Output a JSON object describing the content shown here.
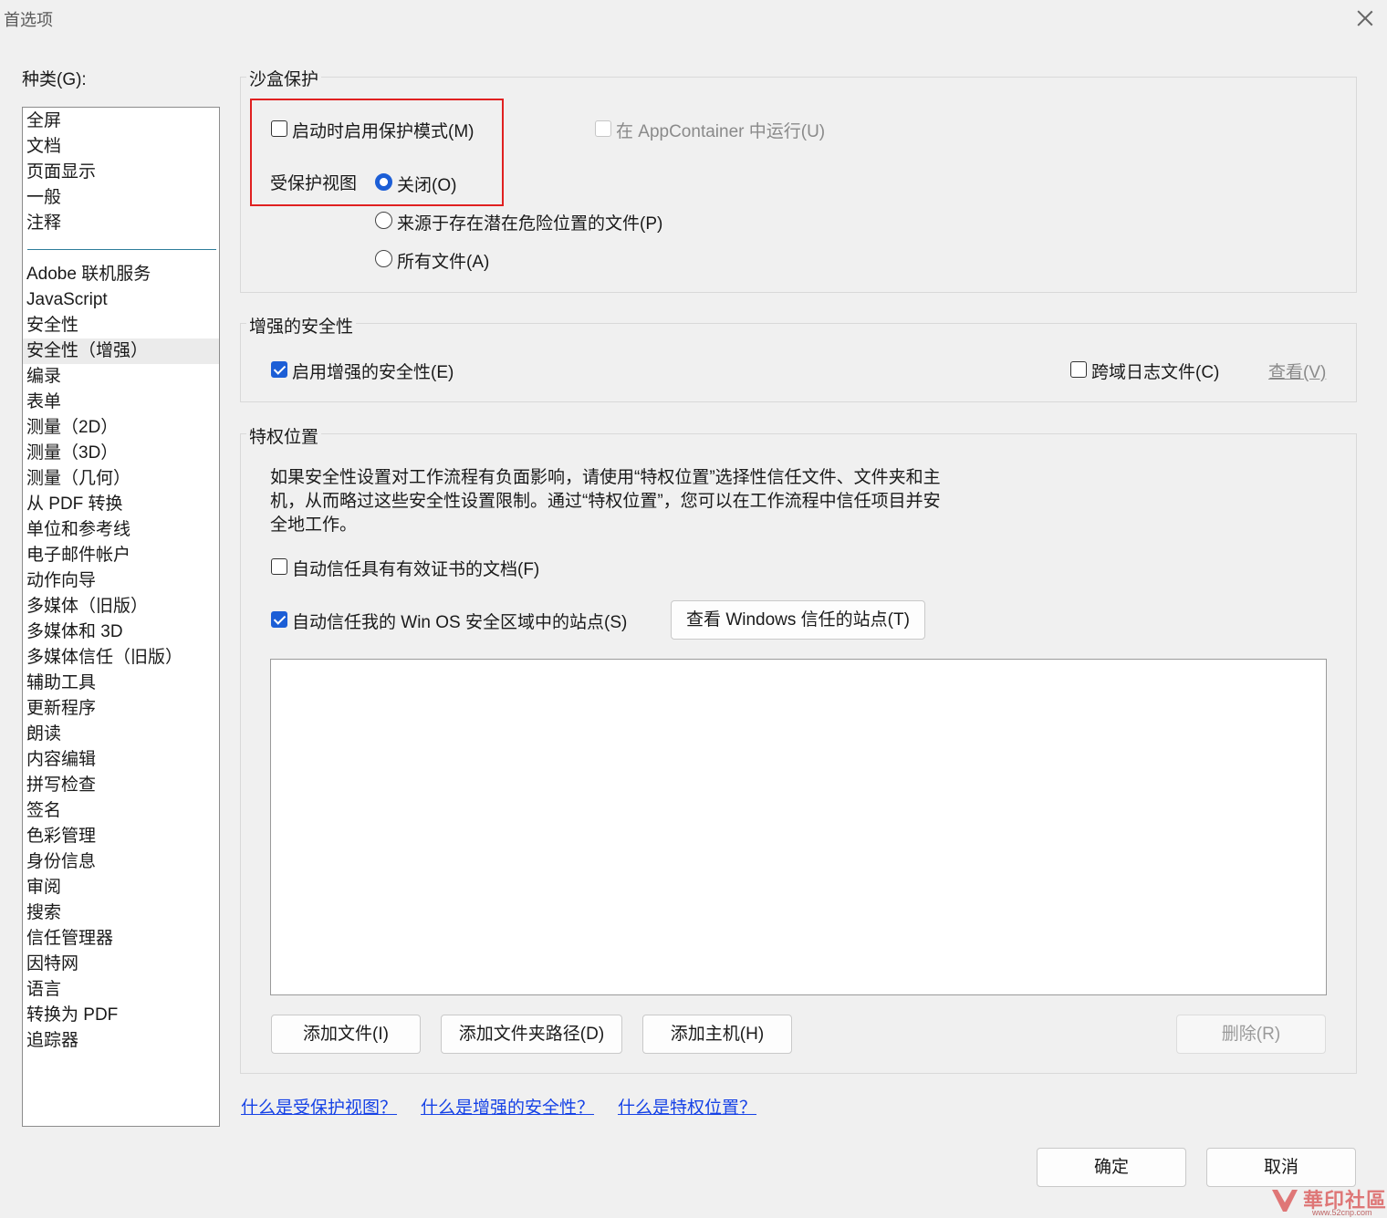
{
  "window": {
    "title": "首选项"
  },
  "categories": {
    "label": "种类(G):",
    "group1": [
      "全屏",
      "文档",
      "页面显示",
      "一般",
      "注释"
    ],
    "group2": [
      "Adobe 联机服务",
      "JavaScript",
      "安全性",
      "安全性（增强）",
      "编录",
      "表单",
      "测量（2D）",
      "测量（3D）",
      "测量（几何）",
      "从 PDF 转换",
      "单位和参考线",
      "电子邮件帐户",
      "动作向导",
      "多媒体（旧版）",
      "多媒体和 3D",
      "多媒体信任（旧版）",
      "辅助工具",
      "更新程序",
      "朗读",
      "内容编辑",
      "拼写检查",
      "签名",
      "色彩管理",
      "身份信息",
      "审阅",
      "搜索",
      "信任管理器",
      "因特网",
      "语言",
      "转换为 PDF",
      "追踪器"
    ],
    "selected": "安全性（增强）"
  },
  "sandbox": {
    "title": "沙盒保护",
    "protected_mode": {
      "label": "启动时启用保护模式(M)",
      "checked": false
    },
    "appcontainer": {
      "label": "在 AppContainer 中运行(U)",
      "checked": false,
      "enabled": false
    },
    "protected_view_label": "受保护视图",
    "options": [
      {
        "label": "关闭(O)",
        "selected": true
      },
      {
        "label": "来源于存在潜在危险位置的文件(P)",
        "selected": false
      },
      {
        "label": "所有文件(A)",
        "selected": false
      }
    ]
  },
  "enhanced": {
    "title": "增强的安全性",
    "enable": {
      "label": "启用增强的安全性(E)",
      "checked": true
    },
    "cross_domain": {
      "label": "跨域日志文件(C)",
      "checked": false
    },
    "view_label": "查看(V)"
  },
  "privileged": {
    "title": "特权位置",
    "description": "如果安全性设置对工作流程有负面影响，请使用“特权位置”选择性信任文件、文件夹和主机，从而略过这些安全性设置限制。通过“特权位置”，您可以在工作流程中信任项目并安全地工作。",
    "auto_trust_certified": {
      "label": "自动信任具有有效证书的文档(F)",
      "checked": false
    },
    "auto_trust_winos": {
      "label": "自动信任我的 Win OS 安全区域中的站点(S)",
      "checked": true
    },
    "view_windows_sites": "查看 Windows 信任的站点(T)",
    "buttons": {
      "add_file": "添加文件(I)",
      "add_folder": "添加文件夹路径(D)",
      "add_host": "添加主机(H)",
      "delete": "删除(R)"
    }
  },
  "links": [
    "什么是受保护视图？",
    "什么是增强的安全性？",
    "什么是特权位置？"
  ],
  "footer": {
    "ok": "确定",
    "cancel": "取消"
  },
  "watermark": {
    "text": "華印社區",
    "url": "www.52cnp.com"
  },
  "colors": {
    "accent": "#1c5ed6",
    "link": "#1642e6",
    "highlight_box": "#e02020"
  }
}
